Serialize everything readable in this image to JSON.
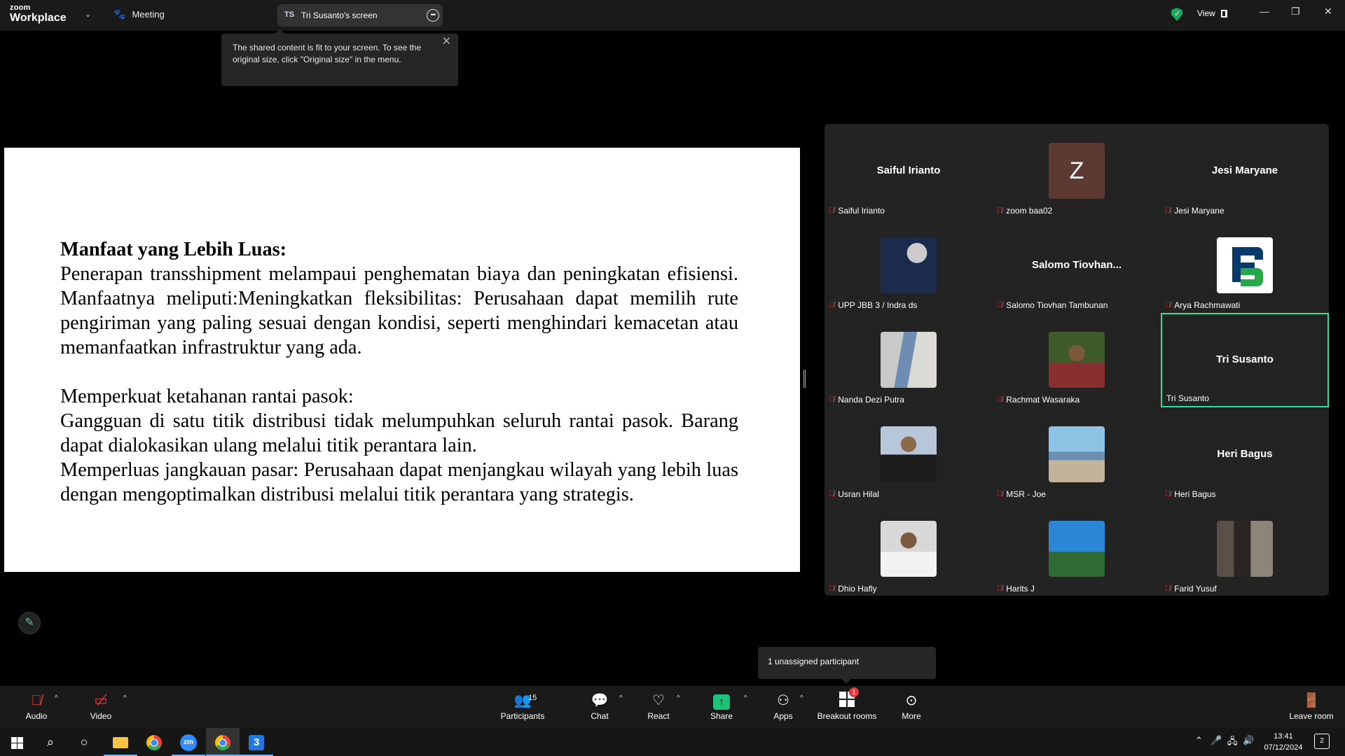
{
  "app": {
    "brand_top": "zoom",
    "brand_bottom": "Workplace"
  },
  "titlebar": {
    "meeting_label": "Meeting",
    "screen_initials": "TS",
    "screen_label": "Tri Susanto's screen",
    "view_label": "View",
    "more_glyph": "•••"
  },
  "tooltip": {
    "text": "The shared content is fit to your screen. To see the original size, click \"Original size\" in the menu."
  },
  "slide": {
    "heading": "Manfaat yang Lebih Luas:",
    "p1": "Penerapan transshipment melampaui penghematan biaya dan peningkatan efisiensi. Manfaatnya meliputi:Meningkatkan fleksibilitas: Perusahaan dapat memilih rute pengiriman yang paling sesuai dengan kondisi, seperti menghindari kemacetan atau memanfaatkan infrastruktur yang ada.",
    "p2": "Memperkuat ketahanan rantai pasok:",
    "p3": "Gangguan di satu titik distribusi tidak melumpuhkan seluruh rantai pasok. Barang dapat dialokasikan ulang melalui titik perantara lain.",
    "p4": "Memperluas jangkauan pasar: Perusahaan dapat menjangkau wilayah yang lebih luas dengan mengoptimalkan distribusi melalui titik perantara yang strategis."
  },
  "participants": [
    {
      "name": "Saiful Irianto",
      "display": "Saiful Irianto",
      "avatar": "none"
    },
    {
      "name": "zoom baa02",
      "display": "",
      "avatar": "letter",
      "letter": "Z"
    },
    {
      "name": "Jesi Maryane",
      "display": "Jesi Maryane",
      "avatar": "none"
    },
    {
      "name": "UPP JBB 3 / Indra ds",
      "display": "",
      "avatar": "moon-photo"
    },
    {
      "name": "Salomo Tiovhan Tambunan",
      "display": "Salomo  Tiovhan...",
      "avatar": "none"
    },
    {
      "name": "Arya Rachmawati",
      "display": "",
      "avatar": "logo"
    },
    {
      "name": "Nanda Dezi Putra",
      "display": "",
      "avatar": "wall-photo"
    },
    {
      "name": "Rachmat Wasaraka",
      "display": "",
      "avatar": "portrait-photo"
    },
    {
      "name": "Tri Susanto",
      "display": "Tri Susanto",
      "avatar": "none",
      "active": true
    },
    {
      "name": "Usran Hilal",
      "display": "",
      "avatar": "portrait-photo"
    },
    {
      "name": "MSR - Joe",
      "display": "",
      "avatar": "beach-photo"
    },
    {
      "name": "Heri Bagus",
      "display": "Heri Bagus",
      "avatar": "none"
    },
    {
      "name": "Dhio Hafly",
      "display": "",
      "avatar": "portrait-photo"
    },
    {
      "name": "Harits J",
      "display": "",
      "avatar": "sky-photo"
    },
    {
      "name": "Farid Yusuf",
      "display": "",
      "avatar": "room-photo"
    }
  ],
  "popover": {
    "unassigned": "1 unassigned participant"
  },
  "toolbar": {
    "audio": "Audio",
    "video": "Video",
    "participants": "Participants",
    "participants_count": "15",
    "chat": "Chat",
    "react": "React",
    "share": "Share",
    "apps": "Apps",
    "breakout": "Breakout rooms",
    "breakout_badge": "1",
    "more": "More",
    "leave": "Leave room"
  },
  "taskbar": {
    "time": "13:41",
    "date": "07/12/2024",
    "notifications": "2",
    "zoom_short": "zm",
    "pinned_app_digit": "3"
  },
  "colors": {
    "active_speaker": "#2ee0a0",
    "muted": "#e23b3b",
    "share": "#1cc27a",
    "security": "#1aa85b"
  }
}
